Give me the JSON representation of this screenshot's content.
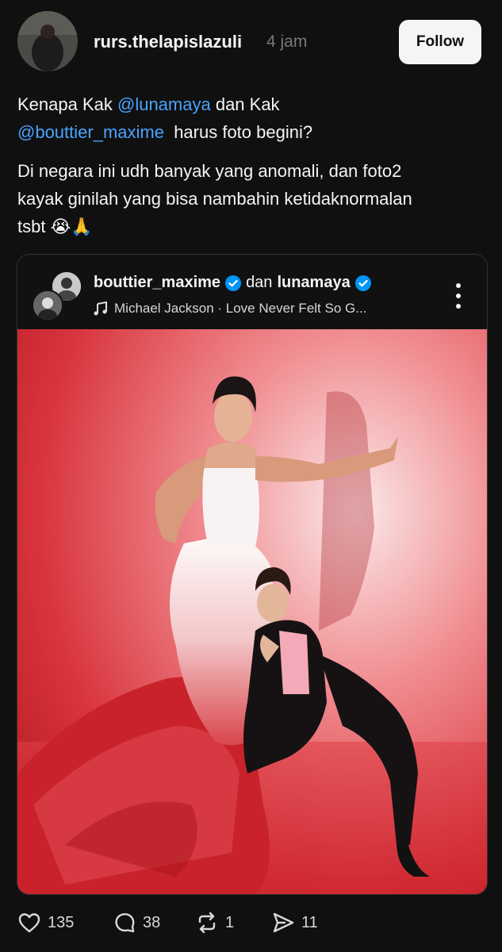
{
  "post": {
    "username": "rurs.thelapislazuli",
    "time": "4 jam",
    "follow_label": "Follow",
    "text": {
      "line1_a": "Kenapa Kak ",
      "mention1": "@lunamaya",
      "line1_b": " dan Kak",
      "mention2": "@bouttier_maxime",
      "line2_b": "  harus foto begini?",
      "para2": "Di negara ini udh banyak yang anomali, dan foto2 kayak ginilah yang bisa nambahin ketidaknormalan tsbt 😭🙏"
    }
  },
  "embed": {
    "user1": "bouttier_maxime",
    "conjunction": "dan",
    "user2": "lunamaya",
    "music": "Michael Jackson · Love Never Felt So G..."
  },
  "actions": {
    "likes": "135",
    "replies": "38",
    "reposts": "1",
    "shares": "11"
  },
  "icons": [
    "heart-icon",
    "reply-icon",
    "repost-icon",
    "share-icon",
    "more-icon",
    "music-note-icon",
    "verified-icon"
  ],
  "colors": {
    "background": "#101010",
    "mention": "#4aa3ff",
    "verified": "#0095f6"
  }
}
